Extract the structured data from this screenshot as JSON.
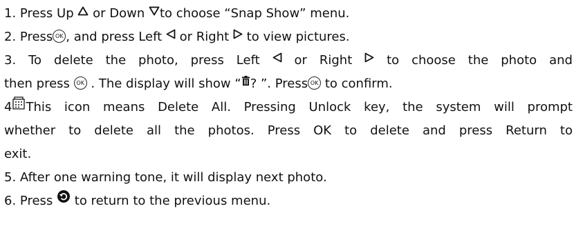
{
  "steps": [
    {
      "number": "1.",
      "t1": "Press Up",
      "t2": "or Down",
      "t3": "to choose “Snap Show” menu."
    },
    {
      "number": "2.",
      "t1": "Press",
      "t2": ", and press Left",
      "t3": "or Right",
      "t4": "to view pictures."
    },
    {
      "number": "3.",
      "t1": "To delete the photo, press Left",
      "t2": "or Right",
      "t3": "to choose the photo and",
      "t4": "then press",
      "t5": ". The display will show “",
      "t6": "? ”. Press",
      "t7": "to confirm."
    },
    {
      "number": "4",
      "t1": "This icon means Delete All. Pressing Unlock key, the system will prompt",
      "t2": "whether to delete all the photos. Press OK to delete and press Return to",
      "t3": "exit."
    },
    {
      "number": "5.",
      "t1": "After one warning tone, it will display next photo."
    },
    {
      "number": "6.",
      "t1": "Press",
      "t2": "to return to the previous menu."
    }
  ],
  "icons": {
    "ok_label": "OK",
    "up": "triangle-up-icon",
    "down": "triangle-down-icon",
    "left": "triangle-left-icon",
    "right": "triangle-right-icon",
    "ok": "ok-button-icon",
    "trash": "trash-icon",
    "delete_all": "delete-all-icon",
    "return": "return-icon"
  }
}
